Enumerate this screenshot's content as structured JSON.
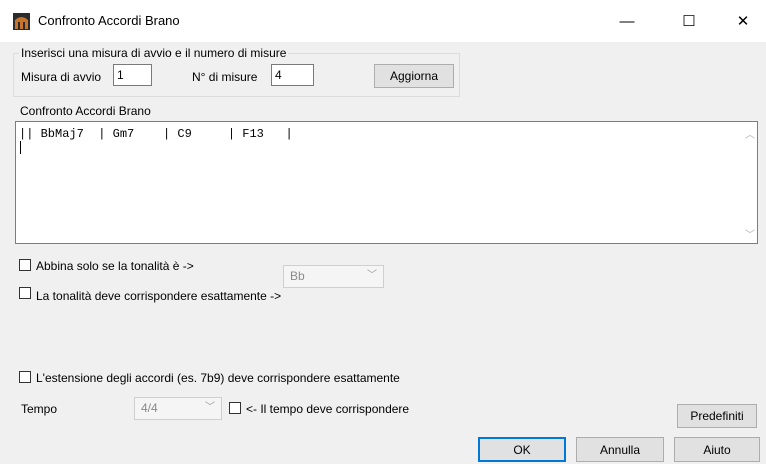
{
  "window": {
    "title": "Confronto Accordi Brano",
    "icon": "app-icon",
    "minimize_glyph": "—",
    "maximize_glyph": "☐",
    "close_glyph": "✕"
  },
  "start_group": {
    "legend": "Inserisci una misura di avvio e il numero di misure",
    "start_label": "Misura di avvio",
    "start_value": "1",
    "count_label": "N° di misure",
    "count_value": "4",
    "update_button": "Aggiorna"
  },
  "chords": {
    "label": "Confronto Accordi Brano",
    "text": "|| BbMaj7  | Gm7    | C9     | F13   |"
  },
  "options": {
    "key_match_label": "Abbina solo se la tonalità è ->",
    "key_exact_label": "La tonalità deve corrispondere esattamente ->",
    "key_value": "Bb",
    "extension_label": "L'estensione degli accordi (es. 7b9) deve corrispondere esattamente",
    "tempo_label": "Tempo",
    "tempo_value": "4/4",
    "tempo_match_label": "<- Il tempo deve corrispondere"
  },
  "buttons": {
    "defaults": "Predefiniti",
    "ok": "OK",
    "cancel": "Annulla",
    "help": "Aiuto"
  },
  "colors": {
    "accent": "#0078d7",
    "background": "#f0f0f0"
  }
}
